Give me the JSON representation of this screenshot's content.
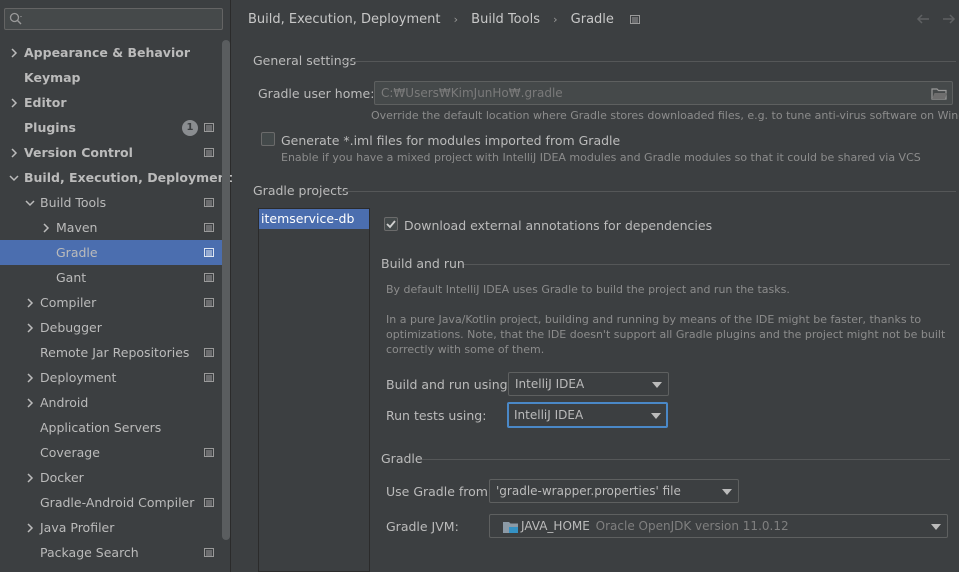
{
  "search": {
    "placeholder": ""
  },
  "sidebar": {
    "items": [
      {
        "label": "Appearance & Behavior",
        "bold": true,
        "chevron": "right",
        "indent": 0
      },
      {
        "label": "Keymap",
        "bold": true,
        "chevron": "none",
        "indent": 0
      },
      {
        "label": "Editor",
        "bold": true,
        "chevron": "right",
        "indent": 0
      },
      {
        "label": "Plugins",
        "bold": true,
        "chevron": "none",
        "indent": 0,
        "badge": "1",
        "config": true
      },
      {
        "label": "Version Control",
        "bold": true,
        "chevron": "right",
        "indent": 0,
        "config": true
      },
      {
        "label": "Build, Execution, Deployment",
        "bold": true,
        "chevron": "down",
        "indent": 0
      },
      {
        "label": "Build Tools",
        "bold": false,
        "chevron": "down",
        "indent": 1,
        "config": true
      },
      {
        "label": "Maven",
        "bold": false,
        "chevron": "right",
        "indent": 2,
        "config": true
      },
      {
        "label": "Gradle",
        "bold": false,
        "chevron": "none",
        "indent": 2,
        "config": true,
        "selected": true
      },
      {
        "label": "Gant",
        "bold": false,
        "chevron": "none",
        "indent": 2,
        "config": true
      },
      {
        "label": "Compiler",
        "bold": false,
        "chevron": "right",
        "indent": 1,
        "config": true
      },
      {
        "label": "Debugger",
        "bold": false,
        "chevron": "right",
        "indent": 1
      },
      {
        "label": "Remote Jar Repositories",
        "bold": false,
        "chevron": "none",
        "indent": 1,
        "config": true
      },
      {
        "label": "Deployment",
        "bold": false,
        "chevron": "right",
        "indent": 1,
        "config": true
      },
      {
        "label": "Android",
        "bold": false,
        "chevron": "right",
        "indent": 1
      },
      {
        "label": "Application Servers",
        "bold": false,
        "chevron": "none",
        "indent": 1
      },
      {
        "label": "Coverage",
        "bold": false,
        "chevron": "none",
        "indent": 1,
        "config": true
      },
      {
        "label": "Docker",
        "bold": false,
        "chevron": "right",
        "indent": 1
      },
      {
        "label": "Gradle-Android Compiler",
        "bold": false,
        "chevron": "none",
        "indent": 1,
        "config": true
      },
      {
        "label": "Java Profiler",
        "bold": false,
        "chevron": "right",
        "indent": 1
      },
      {
        "label": "Package Search",
        "bold": false,
        "chevron": "none",
        "indent": 1,
        "config": true
      }
    ]
  },
  "breadcrumb": {
    "items": [
      "Build, Execution, Deployment",
      "Build Tools",
      "Gradle"
    ]
  },
  "general": {
    "title": "General settings",
    "user_home_label": "Gradle user home:",
    "user_home_value": "C:₩Users₩KimJunHo₩.gradle",
    "user_home_hint": "Override the default location where Gradle stores downloaded files, e.g. to tune anti-virus software on Windows",
    "iml_label": "Generate *.iml files for modules imported from Gradle",
    "iml_hint": "Enable if you have a mixed project with IntelliJ IDEA modules and Gradle modules so that it could be shared via VCS"
  },
  "projects": {
    "title": "Gradle projects",
    "items": [
      "itemservice-db"
    ]
  },
  "settings": {
    "download_annotations_label": "Download external annotations for dependencies",
    "build_run_title": "Build and run",
    "build_run_hint1": "By default IntelliJ IDEA uses Gradle to build the project and run the tasks.",
    "build_run_hint2a": "In a pure Java/Kotlin project, building and running by means of the IDE might be faster, thanks to",
    "build_run_hint2b": "optimizations. Note, that the IDE doesn't support all Gradle plugins and the project might not be built",
    "build_run_hint2c": "correctly with some of them.",
    "build_using_label": "Build and run using:",
    "build_using_value": "IntelliJ IDEA",
    "tests_using_label": "Run tests using:",
    "tests_using_value": "IntelliJ IDEA",
    "gradle_title": "Gradle",
    "use_gradle_label": "Use Gradle from:",
    "use_gradle_value": "'gradle-wrapper.properties' file",
    "jvm_label": "Gradle JVM:",
    "jvm_value_main": "JAVA_HOME",
    "jvm_value_detail": "Oracle OpenJDK version 11.0.12"
  },
  "colors": {
    "selection": "#4b6eaf",
    "focus": "#4a88c7",
    "background": "#3c3f41"
  }
}
